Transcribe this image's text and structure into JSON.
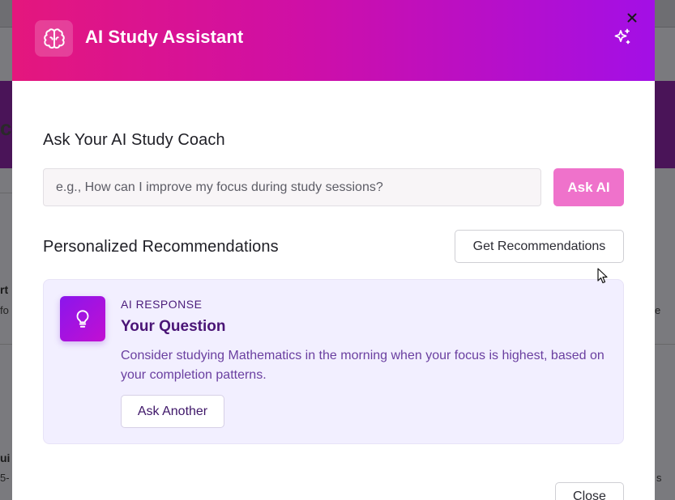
{
  "background": {
    "fragments": [
      {
        "text": "c"
      },
      {
        "text": "rt"
      },
      {
        "text": "fo"
      },
      {
        "text": "e"
      },
      {
        "text": "ui"
      },
      {
        "text": "5-"
      },
      {
        "text": "s"
      }
    ]
  },
  "modal": {
    "header": {
      "title": "AI Study Assistant",
      "logo_icon": "brain-icon",
      "decor_icon": "sparkles-icon",
      "close_icon": "close-icon"
    },
    "ask_section": {
      "title": "Ask Your AI Study Coach",
      "input_value": "",
      "input_placeholder": "e.g., How can I improve my focus during study sessions?",
      "ask_button": "Ask AI"
    },
    "recommendations": {
      "title": "Personalized Recommendations",
      "button": "Get Recommendations"
    },
    "response_card": {
      "icon": "lightbulb-icon",
      "eyebrow": "AI RESPONSE",
      "title": "Your Question",
      "body": "Consider studying Mathematics in the morning when your focus is highest, based on your completion patterns.",
      "ask_another_button": "Ask Another"
    },
    "footer": {
      "close_button": "Close"
    }
  },
  "colors": {
    "header_gradient_start": "#e4177d",
    "header_gradient_end": "#a30fe6",
    "ask_button": "#ef72cb",
    "card_background": "#f2efff",
    "card_title": "#4a1576",
    "card_body": "#6a3fa0"
  }
}
